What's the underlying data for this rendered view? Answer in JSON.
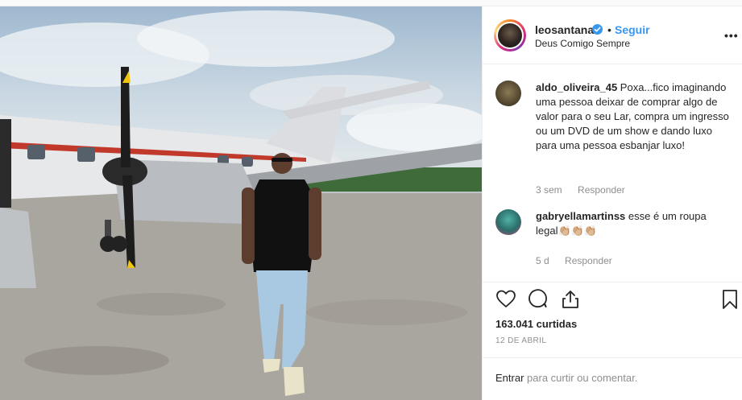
{
  "post": {
    "username": "leosantana",
    "follow_label": "Seguir",
    "separator": "•",
    "location": "Deus Comigo Sempre",
    "more_label": "•••"
  },
  "comments": [
    {
      "username": "aldo_oliveira_45",
      "text": "Poxa...fico imaginando uma pessoa deixar de comprar algo de valor para o seu Lar, compra um ingresso ou um DVD de um show e dando luxo para uma pessoa esbanjar luxo!",
      "age": "3 sem",
      "reply_label": "Responder"
    },
    {
      "username": "gabryellamartinss",
      "text": "esse é um roupa legal👏🏼👏🏼👏🏼",
      "age": "5 d",
      "reply_label": "Responder"
    }
  ],
  "stats": {
    "likes": "163.041 curtidas",
    "date": "12 DE ABRIL"
  },
  "comment_box": {
    "login_link": "Entrar",
    "prompt": "para curtir ou comentar."
  },
  "colors": {
    "link_blue": "#3897f0",
    "text": "#262626",
    "muted": "#8e8e8e",
    "border": "#efefef"
  },
  "icons": {
    "like": "heart-icon",
    "comment": "speech-bubble-icon",
    "share": "share-icon",
    "save": "bookmark-icon",
    "verified": "verified-badge-icon"
  }
}
